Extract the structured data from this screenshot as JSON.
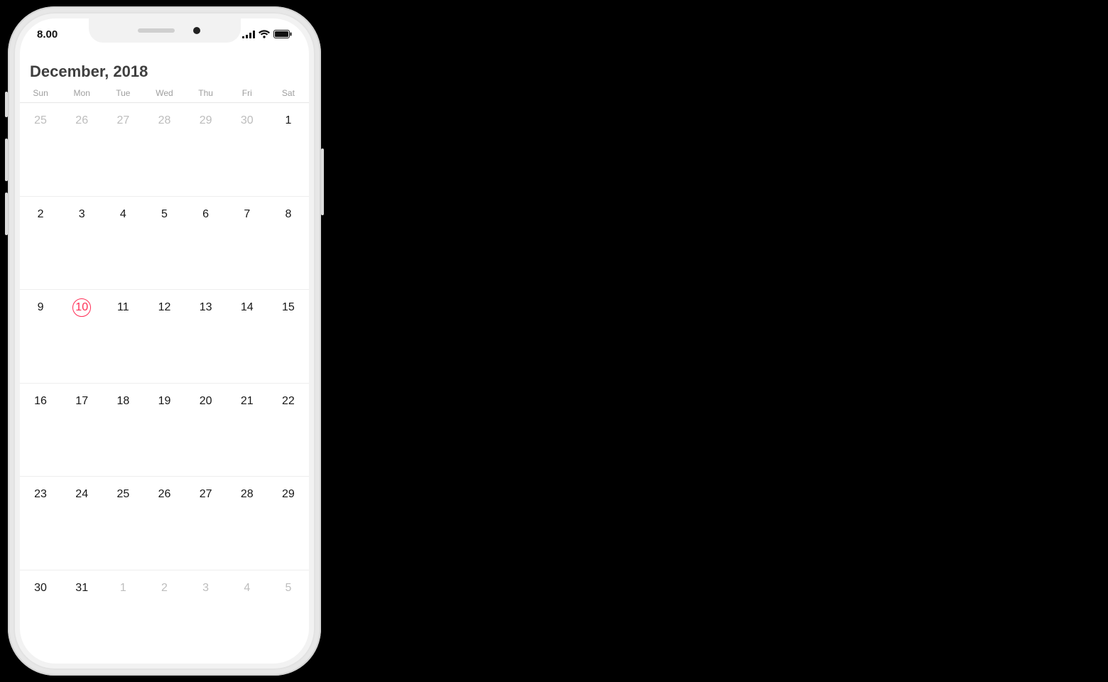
{
  "statusbar": {
    "time": "8.00"
  },
  "calendar": {
    "title": "December, 2018",
    "weekdays": [
      "Sun",
      "Mon",
      "Tue",
      "Wed",
      "Thu",
      "Fri",
      "Sat"
    ],
    "days": [
      {
        "n": "25",
        "current": false,
        "today": false
      },
      {
        "n": "26",
        "current": false,
        "today": false
      },
      {
        "n": "27",
        "current": false,
        "today": false
      },
      {
        "n": "28",
        "current": false,
        "today": false
      },
      {
        "n": "29",
        "current": false,
        "today": false
      },
      {
        "n": "30",
        "current": false,
        "today": false
      },
      {
        "n": "1",
        "current": true,
        "today": false
      },
      {
        "n": "2",
        "current": true,
        "today": false
      },
      {
        "n": "3",
        "current": true,
        "today": false
      },
      {
        "n": "4",
        "current": true,
        "today": false
      },
      {
        "n": "5",
        "current": true,
        "today": false
      },
      {
        "n": "6",
        "current": true,
        "today": false
      },
      {
        "n": "7",
        "current": true,
        "today": false
      },
      {
        "n": "8",
        "current": true,
        "today": false
      },
      {
        "n": "9",
        "current": true,
        "today": false
      },
      {
        "n": "10",
        "current": true,
        "today": true
      },
      {
        "n": "11",
        "current": true,
        "today": false
      },
      {
        "n": "12",
        "current": true,
        "today": false
      },
      {
        "n": "13",
        "current": true,
        "today": false
      },
      {
        "n": "14",
        "current": true,
        "today": false
      },
      {
        "n": "15",
        "current": true,
        "today": false
      },
      {
        "n": "16",
        "current": true,
        "today": false
      },
      {
        "n": "17",
        "current": true,
        "today": false
      },
      {
        "n": "18",
        "current": true,
        "today": false
      },
      {
        "n": "19",
        "current": true,
        "today": false
      },
      {
        "n": "20",
        "current": true,
        "today": false
      },
      {
        "n": "21",
        "current": true,
        "today": false
      },
      {
        "n": "22",
        "current": true,
        "today": false
      },
      {
        "n": "23",
        "current": true,
        "today": false
      },
      {
        "n": "24",
        "current": true,
        "today": false
      },
      {
        "n": "25",
        "current": true,
        "today": false
      },
      {
        "n": "26",
        "current": true,
        "today": false
      },
      {
        "n": "27",
        "current": true,
        "today": false
      },
      {
        "n": "28",
        "current": true,
        "today": false
      },
      {
        "n": "29",
        "current": true,
        "today": false
      },
      {
        "n": "30",
        "current": true,
        "today": false
      },
      {
        "n": "31",
        "current": true,
        "today": false
      },
      {
        "n": "1",
        "current": false,
        "today": false
      },
      {
        "n": "2",
        "current": false,
        "today": false
      },
      {
        "n": "3",
        "current": false,
        "today": false
      },
      {
        "n": "4",
        "current": false,
        "today": false
      },
      {
        "n": "5",
        "current": false,
        "today": false
      }
    ]
  },
  "colors": {
    "accent": "#ff2d55"
  }
}
